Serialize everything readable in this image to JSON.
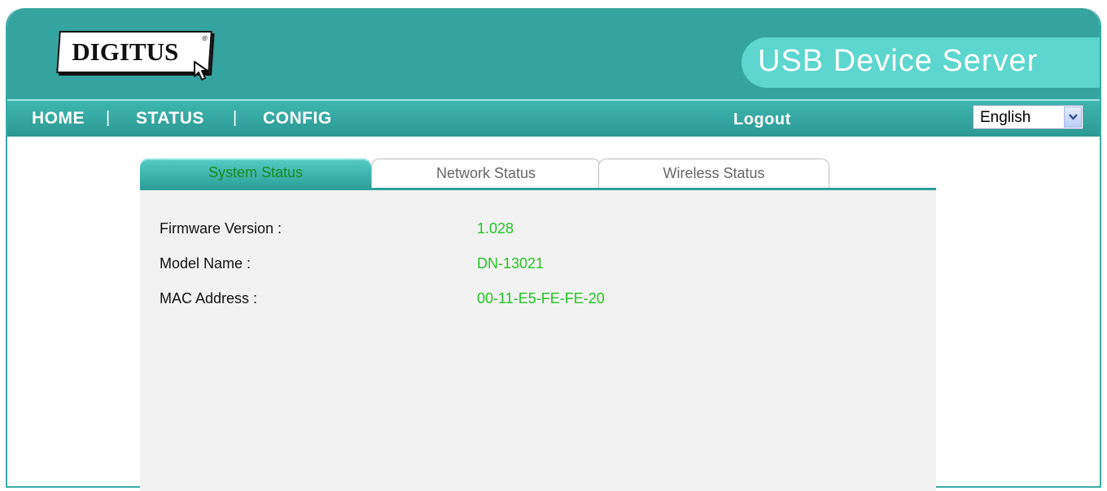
{
  "logo": {
    "text": "DIGITUS",
    "reg": "®"
  },
  "header": {
    "title": "USB Device Server"
  },
  "nav": {
    "home": "HOME",
    "status": "STATUS",
    "config": "CONFIG",
    "separator": "|",
    "logout": "Logout"
  },
  "language": {
    "selected": "English"
  },
  "tabs": [
    {
      "label": "System Status",
      "active": true
    },
    {
      "label": "Network Status",
      "active": false
    },
    {
      "label": "Wireless Status",
      "active": false
    }
  ],
  "system_status": {
    "rows": [
      {
        "label": "Firmware Version :",
        "value": "1.028"
      },
      {
        "label": "Model Name :",
        "value": "DN-13021"
      },
      {
        "label": "MAC Address :",
        "value": "00-11-E5-FE-FE-20"
      }
    ]
  },
  "colors": {
    "teal": "#35a39f",
    "pill": "#5cd6cf",
    "value_green": "#22c422"
  },
  "icons": {
    "logo_cursor": "cursor-arrow-icon",
    "dropdown": "chevron-down-icon"
  }
}
